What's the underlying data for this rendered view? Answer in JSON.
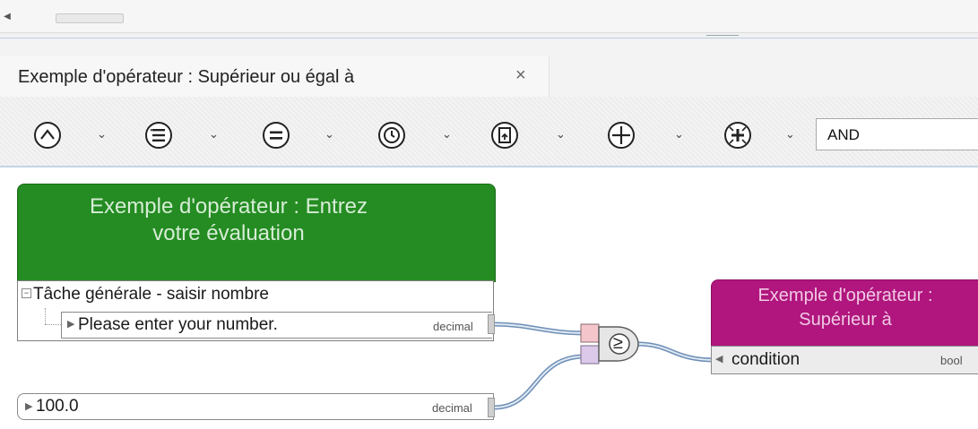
{
  "scrollbar": {
    "left_arrow_icon": "chevron-left-icon"
  },
  "tab": {
    "title": "Exemple d'opérateur : Supérieur ou égal à",
    "close_glyph": "×"
  },
  "toolbar": {
    "buttons": [
      {
        "icon": "caret-up-circle-icon"
      },
      {
        "icon": "list-circle-icon"
      },
      {
        "icon": "equals-circle-icon"
      },
      {
        "icon": "clock-circle-icon"
      },
      {
        "icon": "document-circle-icon"
      },
      {
        "icon": "plus-circle-icon"
      },
      {
        "icon": "plus-star-circle-icon"
      }
    ],
    "chevron_glyph": "⌄",
    "operator_value": "AND"
  },
  "nodes": {
    "source": {
      "title_line1": "Exemple d'opérateur : Entrez",
      "title_line2": "votre évaluation",
      "task_label": "Tâche générale - saisir nombre",
      "field_label": "Please enter your number.",
      "field_type": "decimal",
      "color": "#248c22"
    },
    "constant": {
      "value": "100.0",
      "type": "decimal"
    },
    "operator": {
      "symbol": "≥"
    },
    "target": {
      "title_line1": "Exemple d'opérateur :",
      "title_line2": "Supérieur à",
      "input_label": "condition",
      "input_type": "bool",
      "color": "#b0167d"
    }
  }
}
